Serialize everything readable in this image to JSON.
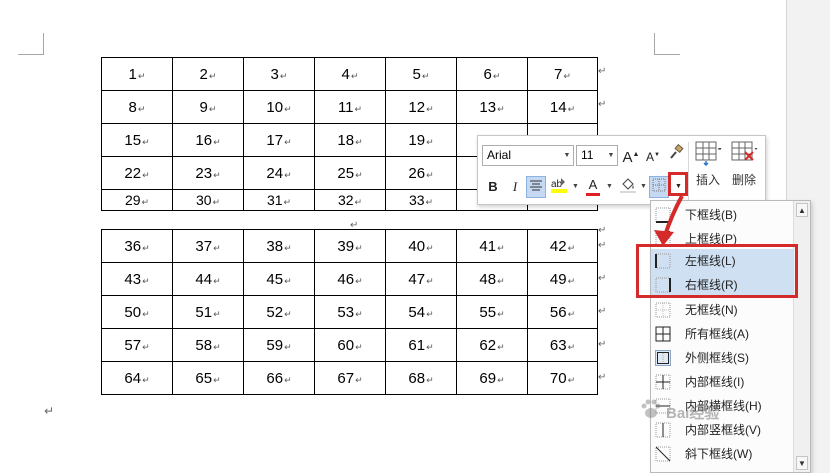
{
  "document": {
    "table_top": {
      "rows": [
        [
          "1",
          "2",
          "3",
          "4",
          "5",
          "6",
          "7"
        ],
        [
          "8",
          "9",
          "10",
          "11",
          "12",
          "13",
          "14"
        ],
        [
          "15",
          "16",
          "17",
          "18",
          "19",
          "",
          ""
        ],
        [
          "22",
          "23",
          "24",
          "25",
          "26",
          "",
          ""
        ],
        [
          "29",
          "30",
          "31",
          "32",
          "33",
          "",
          ""
        ]
      ]
    },
    "table_bottom": {
      "rows": [
        [
          "36",
          "37",
          "38",
          "39",
          "40",
          "41",
          "42"
        ],
        [
          "43",
          "44",
          "45",
          "46",
          "47",
          "48",
          "49"
        ],
        [
          "50",
          "51",
          "52",
          "53",
          "54",
          "55",
          "56"
        ],
        [
          "57",
          "58",
          "59",
          "60",
          "61",
          "62",
          "63"
        ],
        [
          "64",
          "65",
          "66",
          "67",
          "68",
          "69",
          "70"
        ]
      ]
    },
    "cell_mark": "↵",
    "row_mark": "↵"
  },
  "mini_toolbar": {
    "font_name": "Arial",
    "font_size": "11",
    "grow_font": "A",
    "shrink_font": "A",
    "bold": "B",
    "italic": "I",
    "font_color_letter": "A",
    "insert_label": "插入",
    "delete_label": "删除"
  },
  "border_menu": {
    "items": [
      {
        "label": "下框线(B)",
        "icon": "bottom-border-icon"
      },
      {
        "label": "上框线(P)",
        "icon": "top-border-icon"
      },
      {
        "label": "左框线(L)",
        "icon": "left-border-icon"
      },
      {
        "label": "右框线(R)",
        "icon": "right-border-icon"
      },
      {
        "label": "无框线(N)",
        "icon": "no-border-icon"
      },
      {
        "label": "所有框线(A)",
        "icon": "all-borders-icon"
      },
      {
        "label": "外侧框线(S)",
        "icon": "outside-borders-icon"
      },
      {
        "label": "内部框线(I)",
        "icon": "inside-borders-icon"
      },
      {
        "label": "内部横框线(H)",
        "icon": "inside-horizontal-border-icon"
      },
      {
        "label": "内部竖框线(V)",
        "icon": "inside-vertical-border-icon"
      },
      {
        "label": "斜下框线(W)",
        "icon": "diagonal-down-border-icon"
      }
    ],
    "highlighted": [
      "左框线(L)",
      "右框线(R)"
    ]
  },
  "watermark": "Bai经验",
  "colors": {
    "callout_red": "#d42a2a",
    "highlight_blue": "#cfe0f3",
    "font_color_red": "#e02020",
    "highlighter_yellow": "#ffff00"
  }
}
